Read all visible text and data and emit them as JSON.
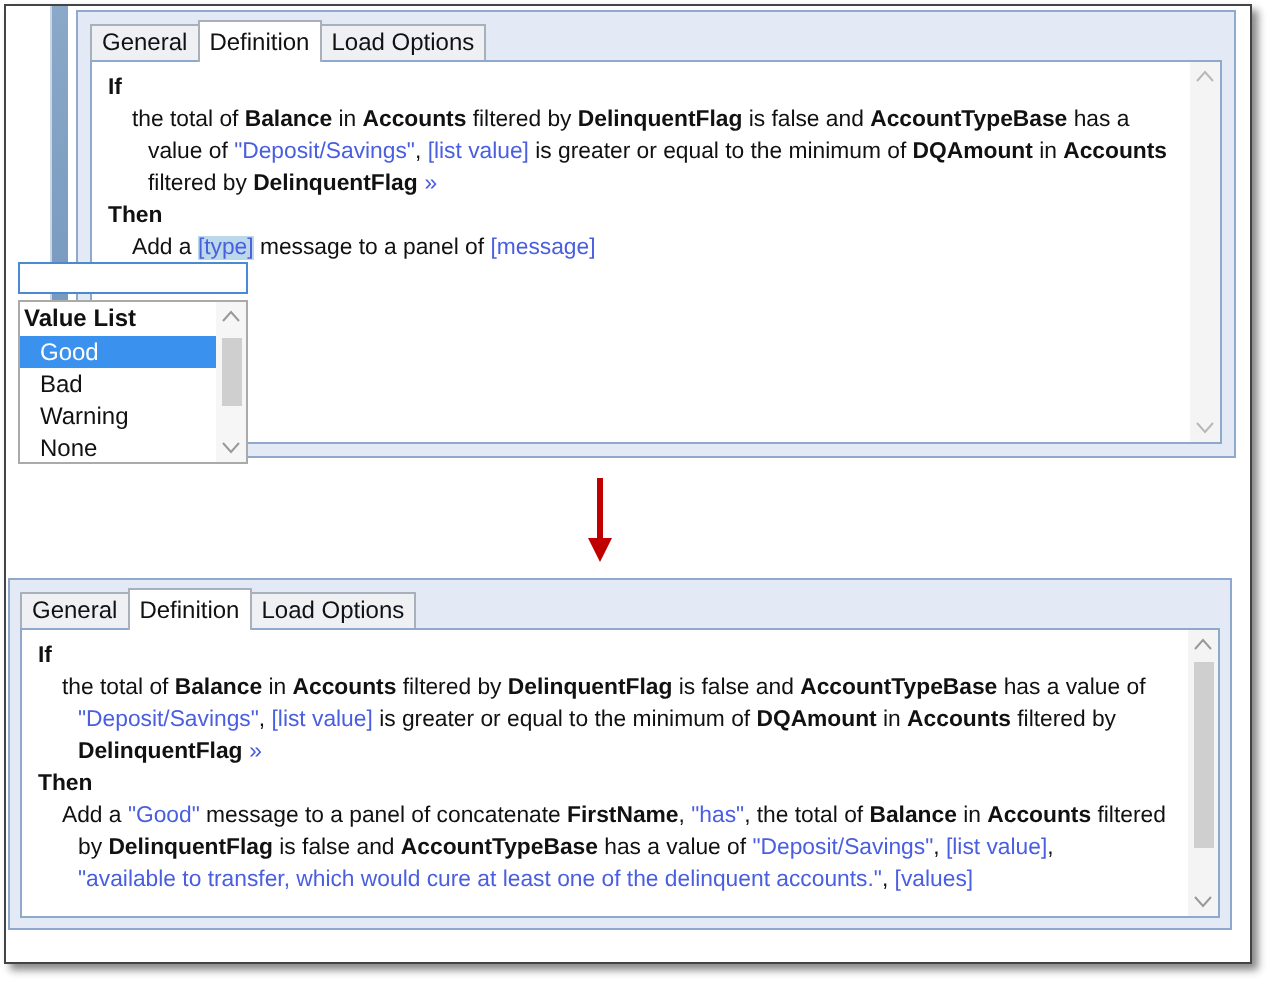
{
  "top_panel": {
    "tabs": [
      {
        "label": "General",
        "selected": false
      },
      {
        "label": "Definition",
        "selected": true
      },
      {
        "label": "Load Options",
        "selected": false
      }
    ],
    "rule": {
      "if_label": "If",
      "then_label": "Then",
      "condition": [
        {
          "kind": "plain",
          "text": "the total of "
        },
        {
          "kind": "field",
          "text": "Balance"
        },
        {
          "kind": "plain",
          "text": " in "
        },
        {
          "kind": "field",
          "text": "Accounts"
        },
        {
          "kind": "plain",
          "text": " filtered by "
        },
        {
          "kind": "field",
          "text": "DelinquentFlag"
        },
        {
          "kind": "plain",
          "text": " is false and "
        },
        {
          "kind": "field",
          "text": "AccountTypeBase"
        },
        {
          "kind": "plain",
          "text": " has a value of "
        },
        {
          "kind": "value",
          "text": "\"Deposit/Savings\""
        },
        {
          "kind": "plain",
          "text": ", "
        },
        {
          "kind": "value",
          "text": "[list value]"
        },
        {
          "kind": "plain",
          "text": " is greater or equal to the minimum of "
        },
        {
          "kind": "field",
          "text": "DQAmount"
        },
        {
          "kind": "plain",
          "text": " in "
        },
        {
          "kind": "field",
          "text": "Accounts"
        },
        {
          "kind": "plain",
          "text": " filtered by "
        },
        {
          "kind": "field",
          "text": "DelinquentFlag"
        },
        {
          "kind": "more",
          "text": "»"
        }
      ],
      "action": [
        {
          "kind": "plain",
          "text": "Add a "
        },
        {
          "kind": "active_value",
          "text": "[type]"
        },
        {
          "kind": "plain",
          "text": " message to a panel of "
        },
        {
          "kind": "value",
          "text": "[message]"
        }
      ]
    },
    "value_picker": {
      "header": "Value List",
      "items": [
        {
          "label": "Good",
          "selected": true
        },
        {
          "label": "Bad",
          "selected": false
        },
        {
          "label": "Warning",
          "selected": false
        },
        {
          "label": "None",
          "selected": false
        }
      ]
    }
  },
  "bottom_panel": {
    "tabs": [
      {
        "label": "General",
        "selected": false
      },
      {
        "label": "Definition",
        "selected": true
      },
      {
        "label": "Load Options",
        "selected": false
      }
    ],
    "rule": {
      "if_label": "If",
      "then_label": "Then",
      "condition": [
        {
          "kind": "plain",
          "text": "the total of "
        },
        {
          "kind": "field",
          "text": "Balance"
        },
        {
          "kind": "plain",
          "text": " in "
        },
        {
          "kind": "field",
          "text": "Accounts"
        },
        {
          "kind": "plain",
          "text": " filtered by "
        },
        {
          "kind": "field",
          "text": "DelinquentFlag"
        },
        {
          "kind": "plain",
          "text": " is false and "
        },
        {
          "kind": "field",
          "text": "AccountTypeBase"
        },
        {
          "kind": "plain",
          "text": " has a value of "
        },
        {
          "kind": "value",
          "text": "\"Deposit/Savings\""
        },
        {
          "kind": "plain",
          "text": ", "
        },
        {
          "kind": "value",
          "text": "[list value]"
        },
        {
          "kind": "plain",
          "text": " is greater or equal to the minimum of "
        },
        {
          "kind": "field",
          "text": "DQAmount"
        },
        {
          "kind": "plain",
          "text": " in "
        },
        {
          "kind": "field",
          "text": "Accounts"
        },
        {
          "kind": "plain",
          "text": " filtered by "
        },
        {
          "kind": "field",
          "text": "DelinquentFlag"
        },
        {
          "kind": "more",
          "text": "»"
        }
      ],
      "action": [
        {
          "kind": "plain",
          "text": "Add a "
        },
        {
          "kind": "value",
          "text": "\"Good\""
        },
        {
          "kind": "plain",
          "text": " message to a panel of concatenate "
        },
        {
          "kind": "field",
          "text": "FirstName"
        },
        {
          "kind": "plain",
          "text": ", "
        },
        {
          "kind": "value",
          "text": "\"has\""
        },
        {
          "kind": "plain",
          "text": ", the total of "
        },
        {
          "kind": "field",
          "text": "Balance"
        },
        {
          "kind": "plain",
          "text": " in "
        },
        {
          "kind": "field",
          "text": "Accounts"
        },
        {
          "kind": "plain",
          "text": " filtered by "
        },
        {
          "kind": "field",
          "text": "DelinquentFlag"
        },
        {
          "kind": "plain",
          "text": " is false and "
        },
        {
          "kind": "field",
          "text": "AccountTypeBase"
        },
        {
          "kind": "plain",
          "text": " has a value of "
        },
        {
          "kind": "value",
          "text": "\"Deposit/Savings\""
        },
        {
          "kind": "plain",
          "text": ", "
        },
        {
          "kind": "value",
          "text": "[list value]"
        },
        {
          "kind": "plain",
          "text": ", "
        },
        {
          "kind": "value",
          "text": "\"available to transfer, which would cure at least one of the delinquent accounts.\""
        },
        {
          "kind": "plain",
          "text": ", "
        },
        {
          "kind": "value",
          "text": "[values]"
        }
      ]
    }
  }
}
